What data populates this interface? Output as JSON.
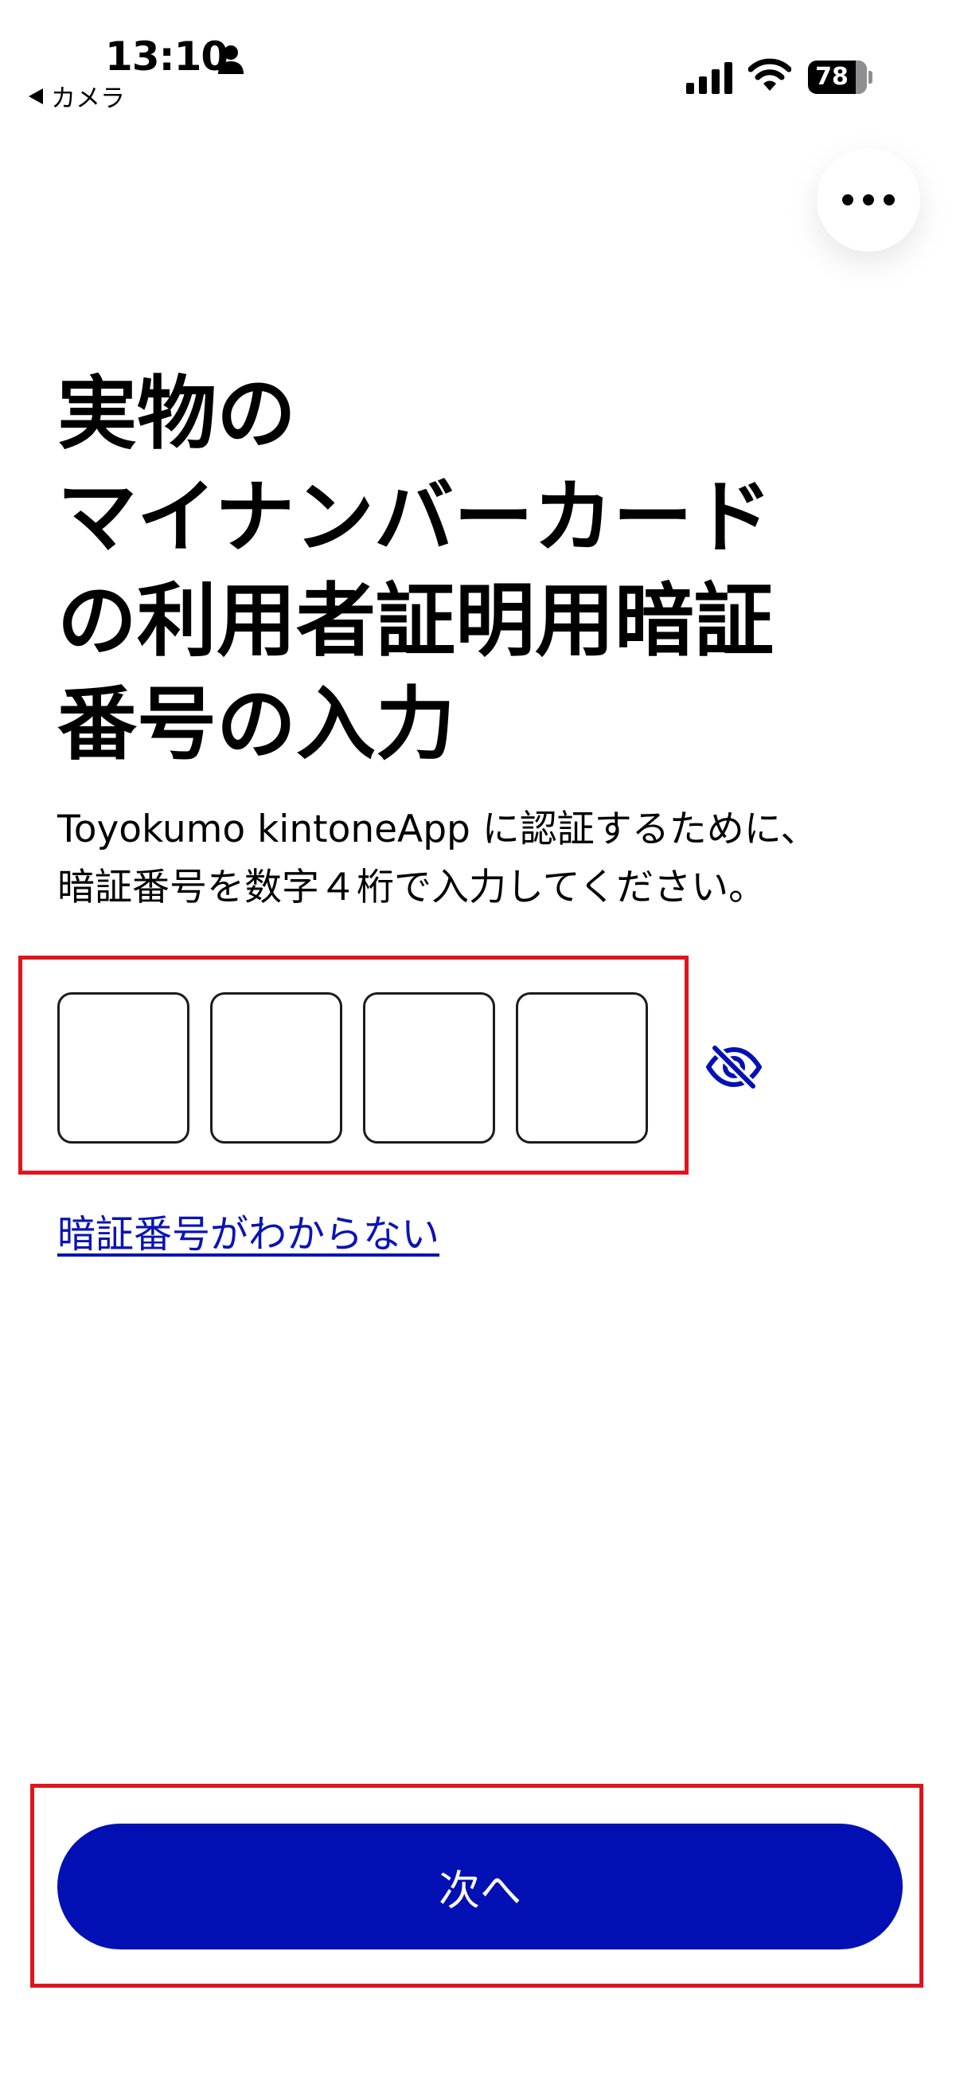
{
  "status_bar": {
    "time": "13:10",
    "back_label": "カメラ",
    "battery_level": "78",
    "icons": [
      "person-icon",
      "signal-icon",
      "wifi-icon",
      "battery-icon"
    ]
  },
  "menu": {
    "icon": "more-icon"
  },
  "title_lines": [
    "実物の",
    "マイナンバーカード",
    "の利用者証明用暗証",
    "番号の入力"
  ],
  "description_lines": [
    "Toyokumo kintoneApp に認証するために、",
    "暗証番号を数字４桁で入力してください。"
  ],
  "pin": {
    "digit_count": 4,
    "digits": [
      "",
      "",
      "",
      ""
    ],
    "visibility_icon": "eye-off-icon"
  },
  "help_link": "暗証番号がわからない",
  "next_button": "次へ",
  "colors": {
    "accent": "#0210b4",
    "link": "#0a14b4",
    "highlight": "#e0141e"
  }
}
